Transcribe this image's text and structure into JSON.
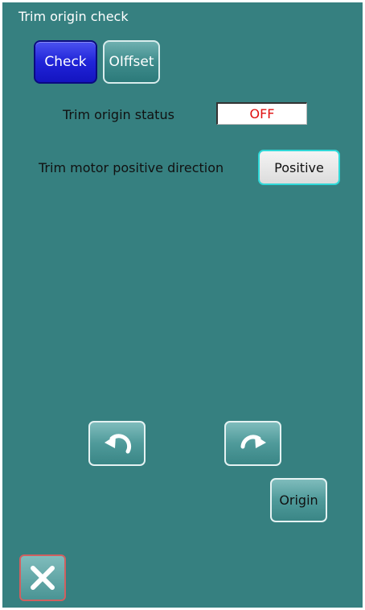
{
  "header": {
    "title": "Trim origin check"
  },
  "tabs": {
    "check_label": "Check",
    "offset_label": "OIffset"
  },
  "trim_origin_status": {
    "label": "Trim origin status",
    "value": "OFF"
  },
  "motor_direction": {
    "label": "Trim motor positive direction",
    "button_label": "Positive"
  },
  "controls": {
    "rotate_left_icon": "rotate-counterclockwise-icon",
    "rotate_right_icon": "rotate-clockwise-icon",
    "origin_label": "Origin",
    "close_icon": "close-icon"
  },
  "colors": {
    "background": "#368080",
    "active_tab": "#2024d8",
    "status_off": "#e01010",
    "positive_border": "#30d8d8"
  }
}
